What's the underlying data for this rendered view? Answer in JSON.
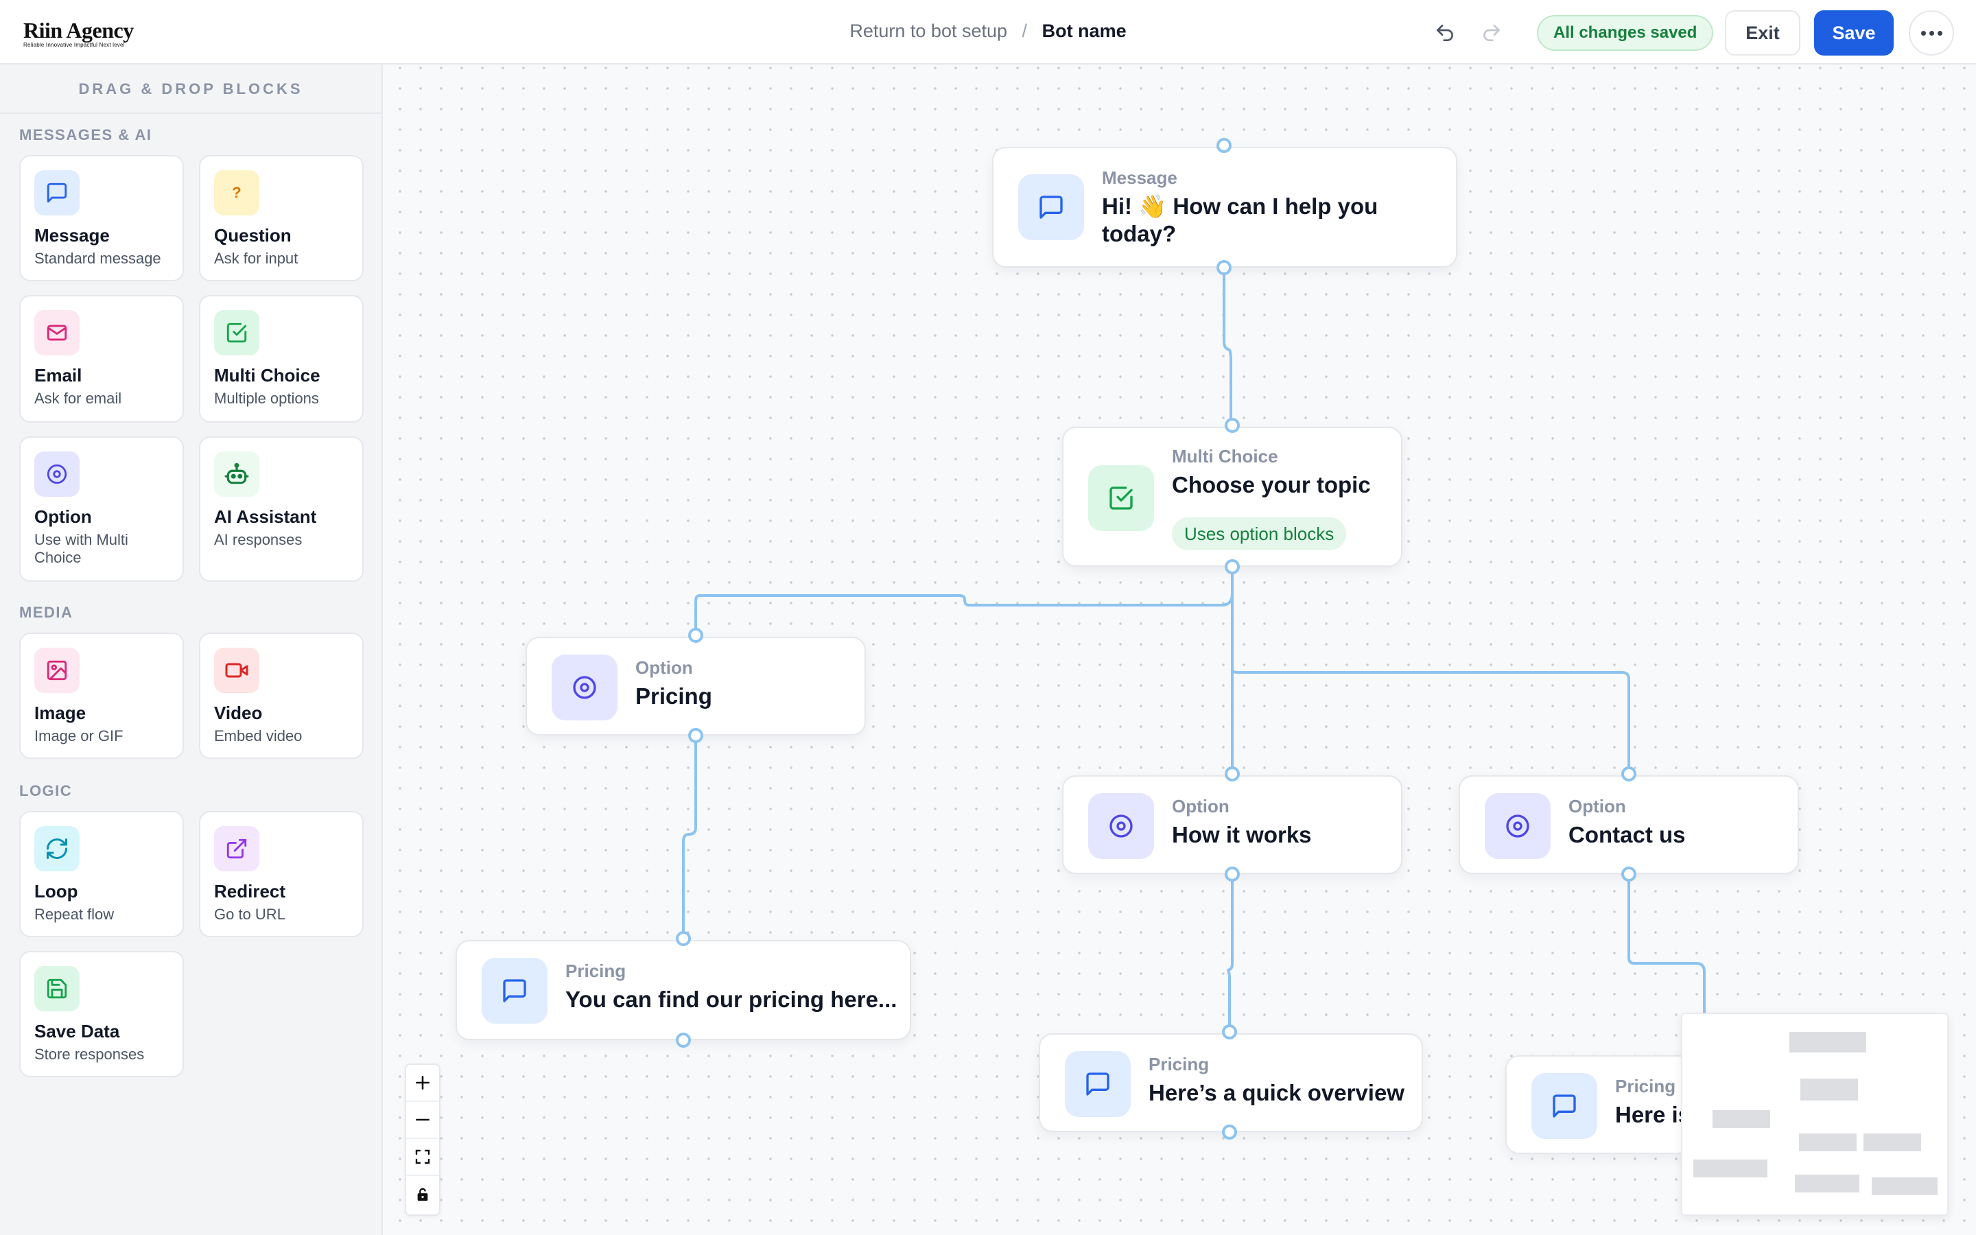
{
  "header": {
    "logo": {
      "name": "Riin Agency",
      "tagline": "Reliable Innovative Impactful Next level"
    },
    "breadcrumb": {
      "back_label": "Return to bot setup",
      "separator": "/",
      "current": "Bot name"
    },
    "status": "All changes saved",
    "exit_label": "Exit",
    "save_label": "Save",
    "icons": {
      "undo": "undo-icon",
      "redo": "redo-icon",
      "more": "more-horizontal-icon"
    }
  },
  "sidebar": {
    "title": "DRAG & DROP BLOCKS",
    "sections": [
      {
        "label": "MESSAGES & AI",
        "blocks": [
          {
            "title": "Message",
            "subtitle": "Standard message",
            "icon": "message-icon",
            "color": "#2563eb"
          },
          {
            "title": "Question",
            "subtitle": "Ask for input",
            "icon": "question-icon",
            "color": "#d97706"
          },
          {
            "title": "Email",
            "subtitle": "Ask for email",
            "icon": "mail-icon",
            "color": "#db2777"
          },
          {
            "title": "Multi Choice",
            "subtitle": "Multiple options",
            "icon": "check-square-icon",
            "color": "#16a34a"
          },
          {
            "title": "Option",
            "subtitle": "Use with Multi Choice",
            "icon": "target-icon",
            "color": "#4f46e5"
          },
          {
            "title": "AI Assistant",
            "subtitle": "AI responses",
            "icon": "bot-icon",
            "color": "#15803d"
          }
        ]
      },
      {
        "label": "MEDIA",
        "blocks": [
          {
            "title": "Image",
            "subtitle": "Image or GIF",
            "icon": "image-icon",
            "color": "#db2777"
          },
          {
            "title": "Video",
            "subtitle": "Embed video",
            "icon": "video-icon",
            "color": "#dc2626"
          }
        ]
      },
      {
        "label": "LOGIC",
        "blocks": [
          {
            "title": "Loop",
            "subtitle": "Repeat flow",
            "icon": "refresh-icon",
            "color": "#0891b2"
          },
          {
            "title": "Redirect",
            "subtitle": "Go to URL",
            "icon": "external-link-icon",
            "color": "#9333ea"
          },
          {
            "title": "Save Data",
            "subtitle": "Store responses",
            "icon": "save-icon",
            "color": "#16a34a"
          }
        ]
      }
    ]
  },
  "canvas": {
    "nodes": [
      {
        "id": "welcome",
        "type": "Message",
        "title": "Hi! 👋 How can I help you",
        "title_line2": "today?",
        "icon": "message-icon"
      },
      {
        "id": "topic",
        "type": "Multi Choice",
        "title": "Choose your topic",
        "chip": "Uses option blocks",
        "icon": "check-square-icon"
      },
      {
        "id": "opt-pricing",
        "type": "Option",
        "title": "Pricing",
        "icon": "target-icon"
      },
      {
        "id": "opt-how",
        "type": "Option",
        "title": "How it works",
        "icon": "target-icon"
      },
      {
        "id": "opt-contact",
        "type": "Option",
        "title": "Contact us",
        "icon": "target-icon"
      },
      {
        "id": "msg-pricing",
        "type": "Pricing",
        "title": "You can find our pricing here...",
        "icon": "message-icon"
      },
      {
        "id": "msg-overview",
        "type": "Pricing",
        "title": "Here’s a quick overview",
        "icon": "message-icon"
      },
      {
        "id": "msg-contact",
        "type": "Pricing",
        "title": "Here is",
        "icon": "message-icon"
      }
    ],
    "zoom_controls": [
      "zoom-in-icon",
      "zoom-out-icon",
      "fit-view-icon",
      "lock-icon"
    ]
  },
  "colors": {
    "accent": "#1d5fe0",
    "edge": "#8cc3f0",
    "success": "#15803d"
  }
}
